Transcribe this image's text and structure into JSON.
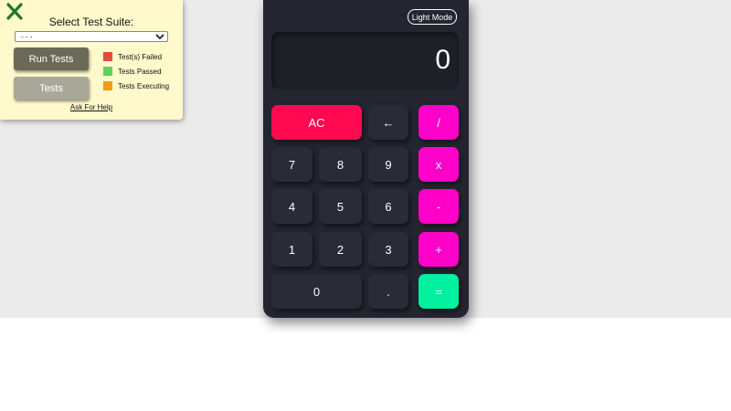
{
  "test_panel": {
    "title": "Select Test Suite:",
    "select_value": "- - -",
    "run_label": "Run Tests",
    "tests_label": "Tests",
    "legend": [
      {
        "label": "Test(s) Failed",
        "color": "#e74c3c"
      },
      {
        "label": "Tests Passed",
        "color": "#5ed35e"
      },
      {
        "label": "Tests Executing",
        "color": "#f39c12"
      }
    ],
    "help_label": "Ask For Help",
    "close_icon": "close-x-icon",
    "close_color": "#1f7a1f"
  },
  "calculator": {
    "mode_label": "Light Mode",
    "display_value": "0",
    "keys": {
      "clear": "AC",
      "backspace": "←",
      "divide": "/",
      "seven": "7",
      "eight": "8",
      "nine": "9",
      "multiply": "x",
      "four": "4",
      "five": "5",
      "six": "6",
      "subtract": "-",
      "one": "1",
      "two": "2",
      "three": "3",
      "add": "+",
      "zero": "0",
      "decimal": ".",
      "equals": "="
    },
    "colors": {
      "body": "#242530",
      "key": "#292b36",
      "operator": "#fe00c8",
      "clear": "#ff0a50",
      "equals": "#00f0a0"
    }
  }
}
